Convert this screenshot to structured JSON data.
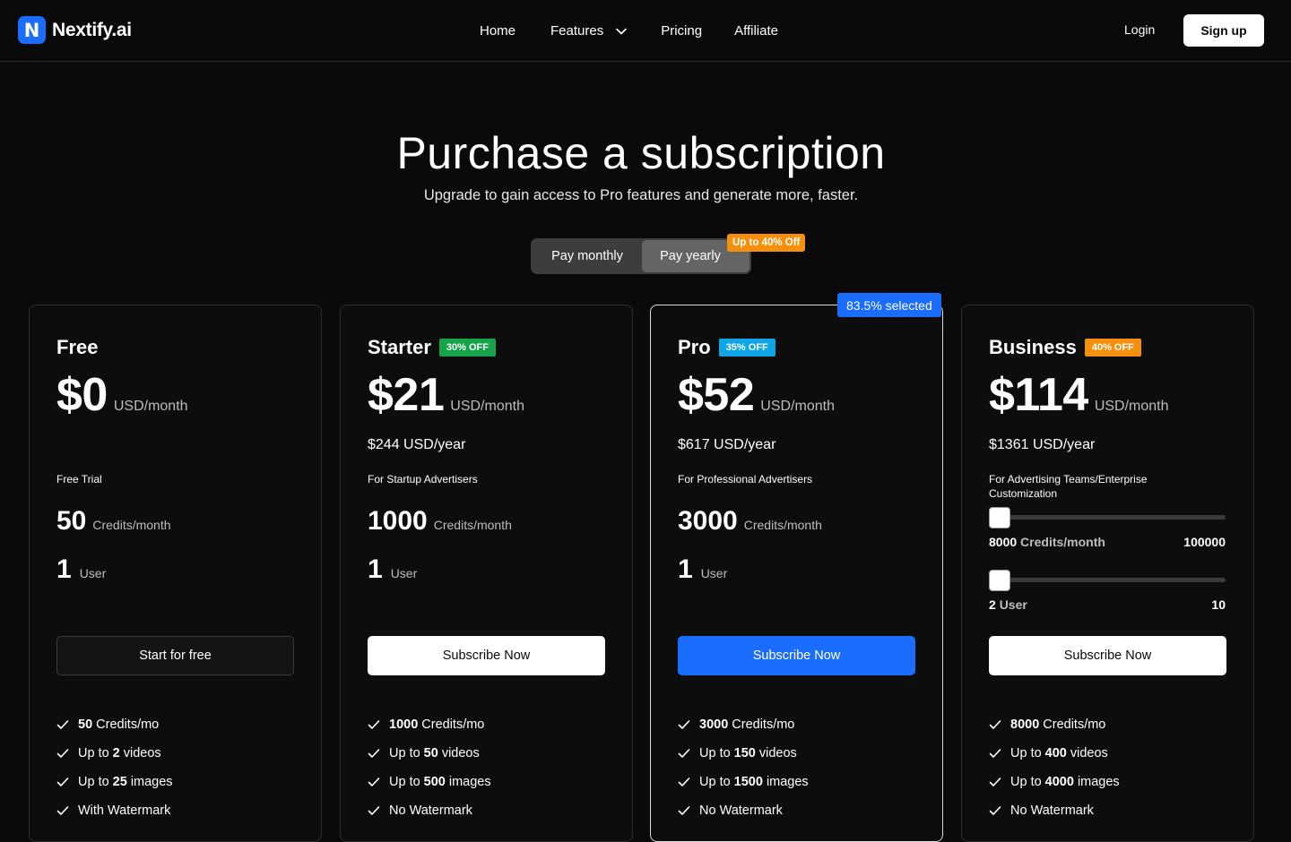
{
  "brand": {
    "logo_letter": "N",
    "name": "Nextify.ai",
    "accent": "#1a6dff"
  },
  "nav": {
    "home": "Home",
    "features": "Features",
    "pricing": "Pricing",
    "affiliate": "Affiliate",
    "login": "Login",
    "signup": "Sign up"
  },
  "hero": {
    "title": "Purchase a subscription",
    "subtitle": "Upgrade to gain access to Pro features and generate more, faster."
  },
  "billing_toggle": {
    "monthly": "Pay monthly",
    "yearly": "Pay yearly",
    "selected": "Pay yearly",
    "badge": "Up to 40% Off"
  },
  "plans": [
    {
      "name": "Free",
      "discount": "",
      "price": "$0",
      "price_unit": "USD/month",
      "yearly": "",
      "audience": "Free Trial",
      "credits": "50",
      "credits_unit": "Credits/month",
      "users": "1",
      "users_unit": "User",
      "cta": "Start for free",
      "features": [
        {
          "pre": "",
          "bold": "50",
          "post": "Credits/mo"
        },
        {
          "pre": "Up to",
          "bold": "2",
          "post": "videos"
        },
        {
          "pre": "Up to",
          "bold": "25",
          "post": "images"
        },
        {
          "pre": "With Watermark",
          "bold": "",
          "post": ""
        }
      ]
    },
    {
      "name": "Starter",
      "discount": "30% OFF",
      "discount_color": "#16a34a",
      "price": "$21",
      "price_unit": "USD/month",
      "yearly": "$244 USD/year",
      "audience": "For Startup Advertisers",
      "credits": "1000",
      "credits_unit": "Credits/month",
      "users": "1",
      "users_unit": "User",
      "cta": "Subscribe Now",
      "features": [
        {
          "pre": "",
          "bold": "1000",
          "post": "Credits/mo"
        },
        {
          "pre": "Up to",
          "bold": "50",
          "post": "videos"
        },
        {
          "pre": "Up to",
          "bold": "500",
          "post": "images"
        },
        {
          "pre": "No Watermark",
          "bold": "",
          "post": ""
        }
      ]
    },
    {
      "name": "Pro",
      "discount": "35% OFF",
      "discount_color": "#0ea5e9",
      "selected_badge": "83.5% selected",
      "price": "$52",
      "price_unit": "USD/month",
      "yearly": "$617 USD/year",
      "audience": "For Professional Advertisers",
      "credits": "3000",
      "credits_unit": "Credits/month",
      "users": "1",
      "users_unit": "User",
      "cta": "Subscribe Now",
      "features": [
        {
          "pre": "",
          "bold": "3000",
          "post": "Credits/mo"
        },
        {
          "pre": "Up to",
          "bold": "150",
          "post": "videos"
        },
        {
          "pre": "Up to",
          "bold": "1500",
          "post": "images"
        },
        {
          "pre": "No Watermark",
          "bold": "",
          "post": ""
        }
      ]
    },
    {
      "name": "Business",
      "discount": "40% OFF",
      "discount_color": "#f5900c",
      "price": "$114",
      "price_unit": "USD/month",
      "yearly": "$1361 USD/year",
      "audience": "For Advertising Teams/Enterprise Customization",
      "credits_slider": {
        "value": "8000",
        "unit": "Credits/month",
        "max": "100000",
        "level": 0.0
      },
      "users_slider": {
        "value": "2",
        "unit": "User",
        "max": "10",
        "level": 0.0
      },
      "cta": "Subscribe Now",
      "features": [
        {
          "pre": "",
          "bold": "8000",
          "post": "Credits/mo"
        },
        {
          "pre": "Up to",
          "bold": "400",
          "post": "videos"
        },
        {
          "pre": "Up to",
          "bold": "4000",
          "post": "images"
        },
        {
          "pre": "No Watermark",
          "bold": "",
          "post": ""
        }
      ]
    }
  ],
  "icons": {
    "features_dropdown": "chevron-down-icon",
    "feature_bullet": "check-icon"
  }
}
